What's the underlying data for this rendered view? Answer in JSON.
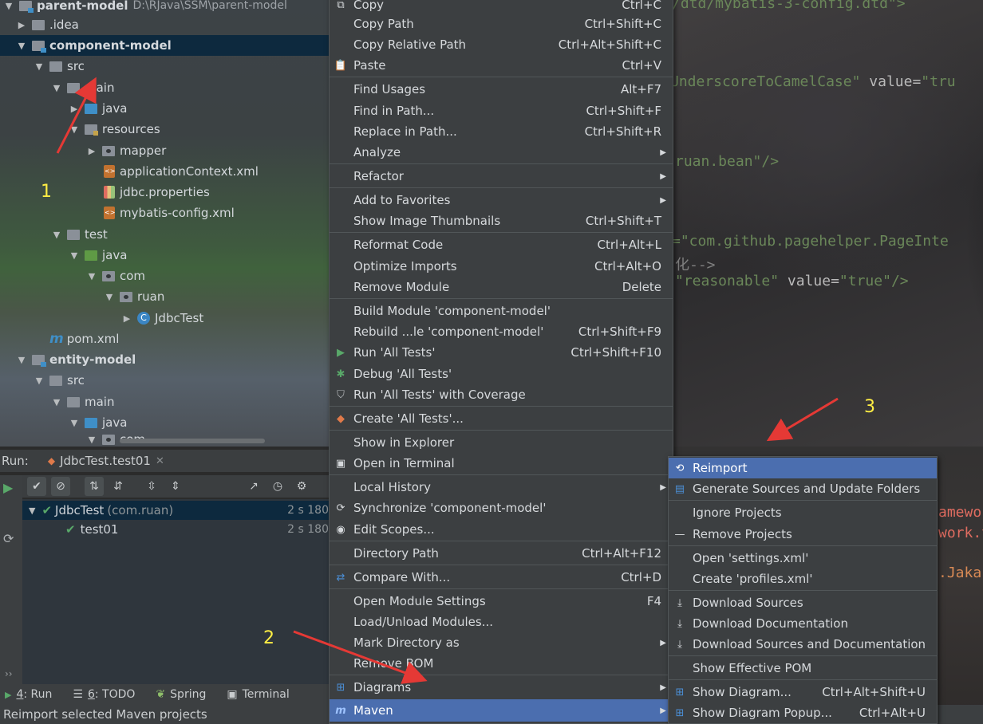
{
  "editor": {
    "line1": "/dtd/mybatis-3-config.dtd\">",
    "line2_attr": "UnderscoreToCamelCase\"",
    "line2_value_key": "value=",
    "line2_value": "\"tru",
    "line3": "ruan.bean\"/>",
    "line4": "=\"com.github.pagehelper.PageInte",
    "line5": "化-->",
    "line6_a": "\"reasonable\"",
    "line6_key": "value=",
    "line6_b": "\"true\"/>",
    "lower1": "amewor",
    "lower2": "work.t",
    "lower3": ".Jaka"
  },
  "tree": {
    "rows": [
      {
        "label": "parent-model",
        "path": "D:\\RJava\\SSM\\parent-model"
      },
      {
        "label": ".idea"
      },
      {
        "label": "component-model"
      },
      {
        "label": "src"
      },
      {
        "label": "main"
      },
      {
        "label": "java"
      },
      {
        "label": "resources"
      },
      {
        "label": "mapper"
      },
      {
        "label": "applicationContext.xml"
      },
      {
        "label": "jdbc.properties"
      },
      {
        "label": "mybatis-config.xml"
      },
      {
        "label": "test"
      },
      {
        "label": "java"
      },
      {
        "label": "com"
      },
      {
        "label": "ruan"
      },
      {
        "label": "JdbcTest"
      },
      {
        "label": "pom.xml"
      },
      {
        "label": "entity-model"
      },
      {
        "label": "src"
      },
      {
        "label": "main"
      },
      {
        "label": "java"
      },
      {
        "label": "com"
      }
    ]
  },
  "run": {
    "label": "Run:",
    "tab": "JdbcTest.test01",
    "results": [
      {
        "name": "JdbcTest",
        "pkg": "(com.ruan)",
        "time": "2 s 180"
      },
      {
        "name": "test01",
        "time": "2 s 180"
      }
    ]
  },
  "bottom_tabs": [
    {
      "num": "4",
      "label": ": Run"
    },
    {
      "num": "6",
      "label": ": TODO"
    },
    {
      "label": "Spring"
    },
    {
      "label": "Terminal"
    }
  ],
  "status": "Reimport selected Maven projects",
  "context_menu": {
    "items": [
      {
        "label": "Copy",
        "shortcut": "Ctrl+C"
      },
      {
        "label": "Copy Path",
        "shortcut": "Ctrl+Shift+C"
      },
      {
        "label": "Copy Relative Path",
        "shortcut": "Ctrl+Alt+Shift+C"
      },
      {
        "label": "Paste",
        "shortcut": "Ctrl+V"
      },
      {
        "label": "Find Usages",
        "shortcut": "Alt+F7"
      },
      {
        "label": "Find in Path...",
        "shortcut": "Ctrl+Shift+F"
      },
      {
        "label": "Replace in Path...",
        "shortcut": "Ctrl+Shift+R"
      },
      {
        "label": "Analyze"
      },
      {
        "label": "Refactor"
      },
      {
        "label": "Add to Favorites"
      },
      {
        "label": "Show Image Thumbnails",
        "shortcut": "Ctrl+Shift+T"
      },
      {
        "label": "Reformat Code",
        "shortcut": "Ctrl+Alt+L"
      },
      {
        "label": "Optimize Imports",
        "shortcut": "Ctrl+Alt+O"
      },
      {
        "label": "Remove Module",
        "shortcut": "Delete"
      },
      {
        "label": "Build Module 'component-model'"
      },
      {
        "label": "Rebuild ...le 'component-model'",
        "shortcut": "Ctrl+Shift+F9"
      },
      {
        "label": "Run 'All Tests'",
        "shortcut": "Ctrl+Shift+F10"
      },
      {
        "label": "Debug 'All Tests'"
      },
      {
        "label": "Run 'All Tests' with Coverage"
      },
      {
        "label": "Create 'All Tests'..."
      },
      {
        "label": "Show in Explorer"
      },
      {
        "label": "Open in Terminal"
      },
      {
        "label": "Local History"
      },
      {
        "label": "Synchronize 'component-model'"
      },
      {
        "label": "Edit Scopes..."
      },
      {
        "label": "Directory Path",
        "shortcut": "Ctrl+Alt+F12"
      },
      {
        "label": "Compare With...",
        "shortcut": "Ctrl+D"
      },
      {
        "label": "Open Module Settings",
        "shortcut": "F4"
      },
      {
        "label": "Load/Unload Modules..."
      },
      {
        "label": "Mark Directory as"
      },
      {
        "label": "Remove BOM"
      },
      {
        "label": "Diagrams"
      },
      {
        "label": "Maven"
      }
    ]
  },
  "maven_menu": {
    "items": [
      {
        "label": "Reimport"
      },
      {
        "label": "Generate Sources and Update Folders"
      },
      {
        "label": "Ignore Projects"
      },
      {
        "label": "Remove Projects"
      },
      {
        "label": "Open 'settings.xml'"
      },
      {
        "label": "Create 'profiles.xml'"
      },
      {
        "label": "Download Sources"
      },
      {
        "label": "Download Documentation"
      },
      {
        "label": "Download Sources and Documentation"
      },
      {
        "label": "Show Effective POM"
      },
      {
        "label": "Show Diagram...",
        "shortcut": "Ctrl+Alt+Shift+U"
      },
      {
        "label": "Show Diagram Popup...",
        "shortcut": "Ctrl+Alt+U"
      }
    ]
  },
  "annotations": [
    "1",
    "2",
    "3"
  ],
  "colors": {
    "selection": "#0d293e",
    "menu_highlight": "#4b6eaf",
    "annotation": "#ffee44",
    "arrow": "#e53935"
  }
}
